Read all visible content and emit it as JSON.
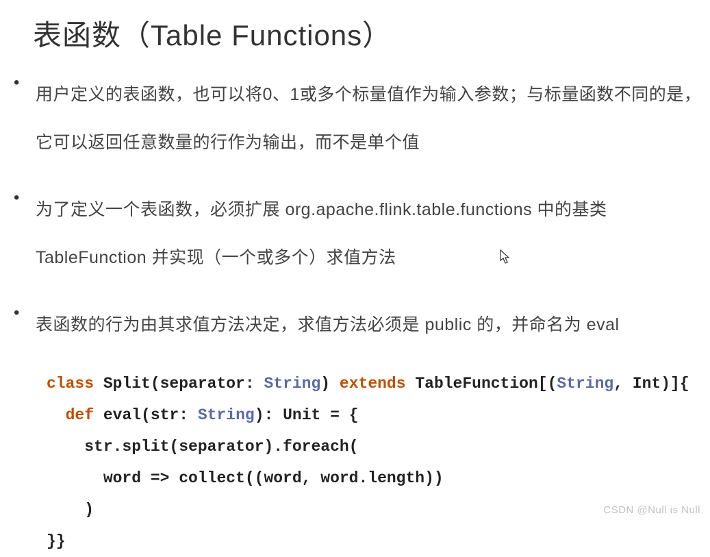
{
  "title": "表函数（Table Functions）",
  "bullets": [
    "用户定义的表函数，也可以将0、1或多个标量值作为输入参数；与标量函数不同的是，它可以返回任意数量的行作为输出，而不是单个值",
    "为了定义一个表函数，必须扩展 org.apache.flink.table.functions 中的基类 TableFunction 并实现（一个或多个）求值方法",
    "表函数的行为由其求值方法决定，求值方法必须是 public 的，并命名为 eval"
  ],
  "code": {
    "kw_class": "class",
    "cls_name": " Split(separator: ",
    "type_string1": "String",
    "after_sep": ") ",
    "kw_extends": "extends",
    "after_extends": " TableFunction[(",
    "type_string2": "String",
    "after_tuple": ", Int)]{",
    "indent1": "  ",
    "kw_def": "def",
    "after_def": " eval(str: ",
    "type_string3": "String",
    "after_str": "): Unit = {",
    "line3": "    str.split(separator).foreach(",
    "line4": "      word => collect((word, word.length))",
    "line5": "    )",
    "line6": "}}"
  },
  "watermark": "CSDN @Null is Null"
}
